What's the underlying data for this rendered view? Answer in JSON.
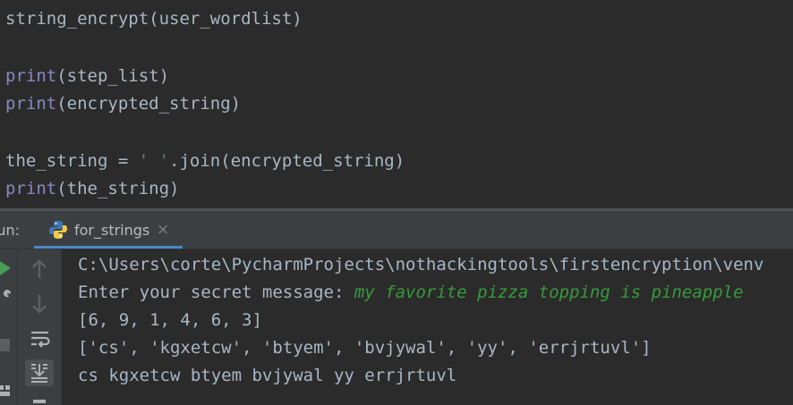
{
  "editor": {
    "lines": [
      {
        "pre": "",
        "fn": "string_encrypt",
        "args": "(user_wordlist)"
      },
      {
        "kw": "print",
        "args": "(step_list)"
      },
      {
        "kw": "print",
        "args": "(encrypted_string)"
      },
      {
        "lhs": "the_string = ",
        "str": "' '",
        "rhs": ".join(encrypted_string)"
      },
      {
        "kw": "print",
        "args": "(the_string)"
      }
    ]
  },
  "run_panel": {
    "label": "Run:",
    "tab_label": "for_strings",
    "close_glyph": "×"
  },
  "console": {
    "path": "C:\\Users\\corte\\PycharmProjects\\nothackingtools\\firstencryption\\venv",
    "prompt": "Enter your secret message: ",
    "user_input": "my favorite pizza topping is pineapple",
    "step_list": "[6, 9, 1, 4, 6, 3]",
    "encrypted_list": "['cs', 'kgxetcw', 'btyem', 'bvjywal', 'yy', 'errjrtuvl']",
    "result": "cs kgxetcw btyem bvjywal yy errjrtuvl"
  },
  "colors": {
    "background": "#2b2b2b",
    "panel": "#3c3f41",
    "text": "#a9b7c6",
    "builtin": "#8888c6",
    "string": "#6a8759",
    "user_input": "#379b3a",
    "run_green": "#499c54",
    "tab_accent": "#4a88c7"
  },
  "icons": [
    "rerun-icon",
    "wrench-icon",
    "stop-icon",
    "layout-icon",
    "arrow-up-icon",
    "arrow-down-icon",
    "soft-wrap-icon",
    "scroll-to-end-icon",
    "python-icon",
    "close-icon"
  ]
}
